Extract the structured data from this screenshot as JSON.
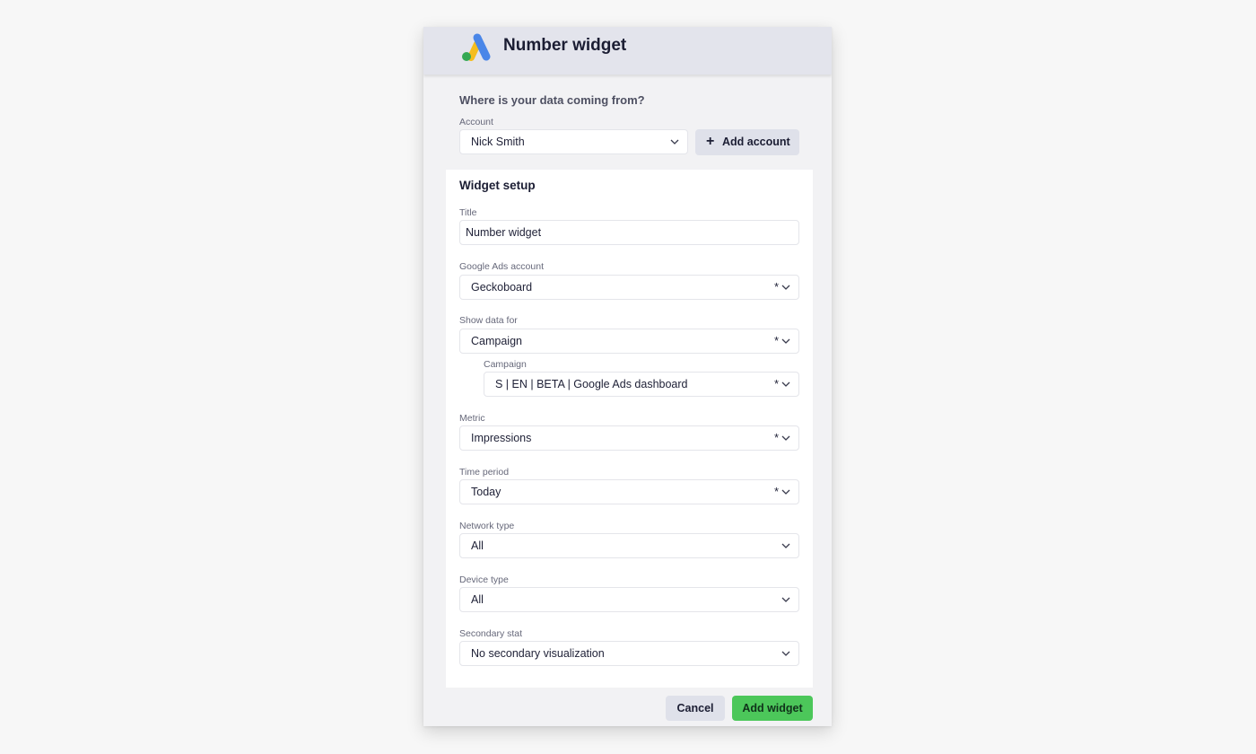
{
  "dialog": {
    "title": "Number widget"
  },
  "source": {
    "question": "Where is your data coming from?",
    "account_label": "Account",
    "account_value": "Nick Smith",
    "add_account_label": "Add account"
  },
  "setup": {
    "heading": "Widget setup",
    "title_label": "Title",
    "title_value": "Number widget",
    "fields": [
      {
        "label": "Google Ads account",
        "value": "Geckoboard",
        "required_mark": "*"
      },
      {
        "label": "Show data for",
        "value": "Campaign",
        "required_mark": "*"
      },
      {
        "label": "Campaign",
        "value": "S | EN | BETA | Google Ads dashboard",
        "required_mark": "*"
      },
      {
        "label": "Metric",
        "value": "Impressions",
        "required_mark": "*"
      },
      {
        "label": "Time period",
        "value": "Today",
        "required_mark": "*"
      },
      {
        "label": "Network type",
        "value": "All"
      },
      {
        "label": "Device type",
        "value": "All"
      },
      {
        "label": "Secondary stat",
        "value": "No secondary visualization"
      }
    ]
  },
  "footer": {
    "cancel_label": "Cancel",
    "add_widget_label": "Add widget"
  },
  "icons": {
    "logo": "google-ads-logo-icon",
    "chevron": "chevron-down-icon",
    "plus": "plus-icon"
  },
  "colors": {
    "header_bg": "#e3e4ec",
    "primary_button": "#4cc75a",
    "secondary_button": "#dfe1ea",
    "logo_blue": "#4a86e8",
    "logo_yellow": "#f5bd1e",
    "logo_green": "#34a853"
  }
}
